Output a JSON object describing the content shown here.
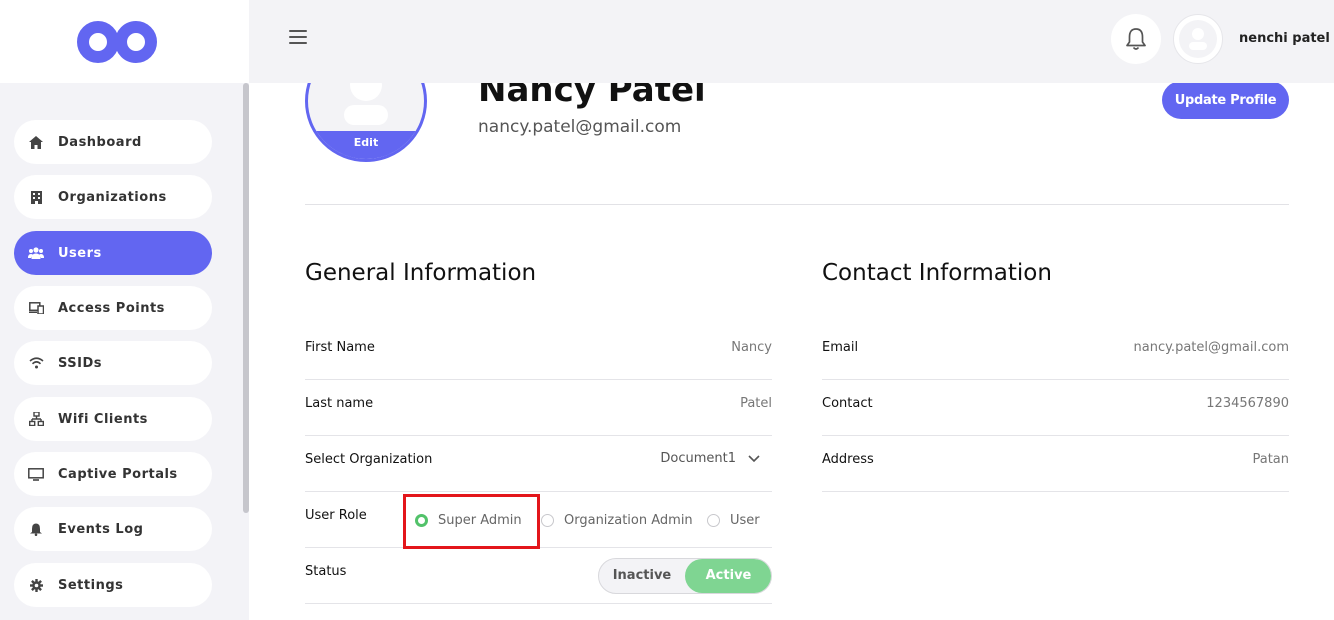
{
  "sidebar": {
    "items": [
      {
        "label": "Dashboard",
        "icon": "home-icon"
      },
      {
        "label": "Organizations",
        "icon": "building-icon"
      },
      {
        "label": "Users",
        "icon": "users-icon",
        "active": true
      },
      {
        "label": "Access Points",
        "icon": "devices-icon"
      },
      {
        "label": "SSIDs",
        "icon": "wifi-icon"
      },
      {
        "label": "Wifi Clients",
        "icon": "network-icon"
      },
      {
        "label": "Captive Portals",
        "icon": "monitor-icon"
      },
      {
        "label": "Events Log",
        "icon": "bell-icon"
      },
      {
        "label": "Settings",
        "icon": "gear-icon"
      }
    ]
  },
  "header": {
    "user_name": "nenchi patel"
  },
  "profile": {
    "name": "Nancy Patel",
    "email": "nancy.patel@gmail.com",
    "edit_label": "Edit",
    "update_button": "Update Profile"
  },
  "general": {
    "title": "General Information",
    "first_name_label": "First Name",
    "first_name": "Nancy",
    "last_name_label": "Last name",
    "last_name": "Patel",
    "org_label": "Select Organization",
    "org_value": "Document1",
    "role_label": "User Role",
    "roles": [
      "Super Admin",
      "Organization Admin",
      "User"
    ],
    "selected_role": "Super Admin",
    "status_label": "Status",
    "status_options": [
      "Inactive",
      "Active"
    ],
    "status_value": "Active"
  },
  "contact": {
    "title": "Contact Information",
    "email_label": "Email",
    "email": "nancy.patel@gmail.com",
    "contact_label": "Contact",
    "contact": "1234567890",
    "address_label": "Address",
    "address": "Patan"
  },
  "colors": {
    "accent": "#6266f1",
    "active_green": "#7fd592",
    "radio_green": "#52c26a",
    "highlight": "#e3161b"
  }
}
